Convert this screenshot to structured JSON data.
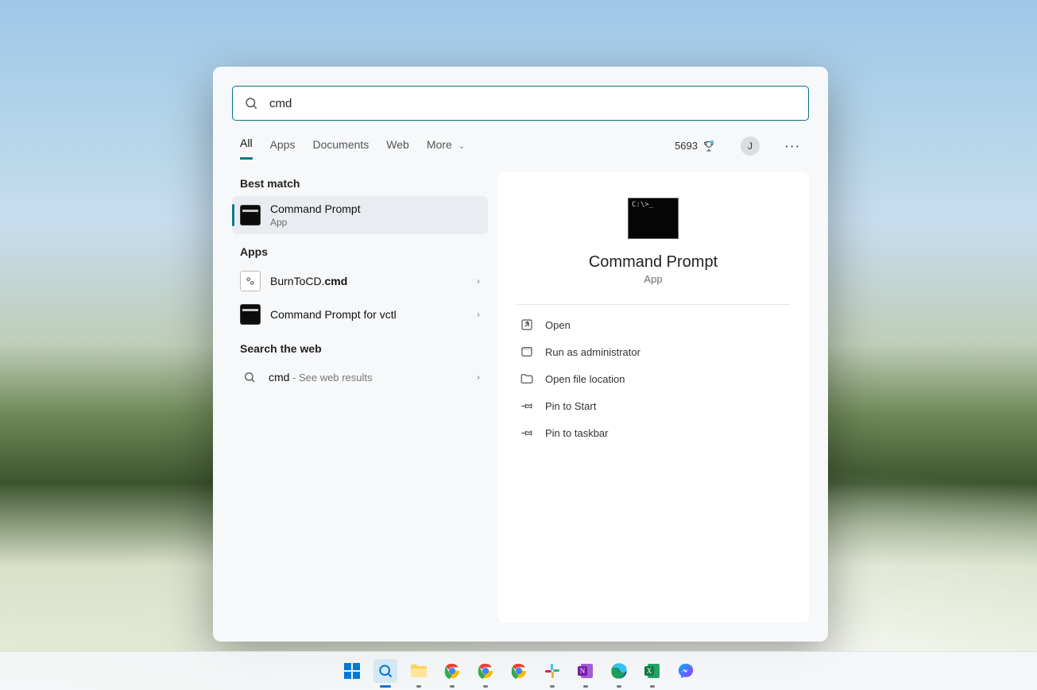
{
  "search": {
    "query": "cmd"
  },
  "tabs": [
    "All",
    "Apps",
    "Documents",
    "Web",
    "More"
  ],
  "rewards_points": "5693",
  "avatar_letter": "J",
  "sections": {
    "best_label": "Best match",
    "apps_label": "Apps",
    "web_label": "Search the web"
  },
  "best_match": {
    "title": "Command Prompt",
    "subtitle": "App"
  },
  "apps": [
    {
      "prefix": "BurnToCD.",
      "bold": "cmd"
    },
    {
      "title": "Command Prompt for vctl"
    }
  ],
  "web": {
    "query": "cmd",
    "hint": " - See web results"
  },
  "right": {
    "title": "Command Prompt",
    "subtitle": "App",
    "actions": [
      "Open",
      "Run as administrator",
      "Open file location",
      "Pin to Start",
      "Pin to taskbar"
    ]
  },
  "taskbar": [
    "start",
    "search",
    "explorer",
    "chrome-1",
    "chrome-2",
    "chrome-3",
    "slack",
    "onenote",
    "edge",
    "excel",
    "messenger"
  ]
}
